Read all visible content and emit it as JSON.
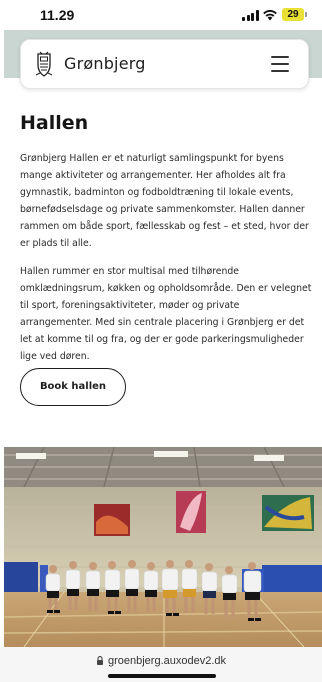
{
  "status_bar": {
    "time": "11.29",
    "battery": "29",
    "battery_color": "#e8e034"
  },
  "header": {
    "brand": "Grønbjerg",
    "logo_icon": "crest-icon",
    "menu_icon": "hamburger-menu-icon",
    "band_color": "#c9d6d2"
  },
  "main": {
    "title": "Hallen",
    "paragraphs": [
      "Grønbjerg Hallen er et naturligt samlingspunkt for byens mange aktiviteter og arrangementer. Her afholdes alt fra gymnastik, badminton og fodboldtræning til lokale events, børnefødselsdage og private sammenkomster. Hallen danner rammen om både sport, fællesskab og fest – et sted, hvor der er plads til alle.",
      "Hallen rummer en stor multisal med tilhørende omklædningsrum, køkken og opholdsområde. Den er velegnet til sport, foreningsaktiviteter, møder og private arrangementer. Med sin centrale placering i Grønbjerg er det let at komme til og fra, og der er gode parkeringsmuligheder lige ved døren."
    ],
    "book_button": "Book hallen"
  },
  "photo": {
    "subject": "group-photo-in-sports-hall"
  },
  "browser": {
    "url": "groenbjerg.auxodev2.dk",
    "lock_icon": "lock-icon"
  }
}
